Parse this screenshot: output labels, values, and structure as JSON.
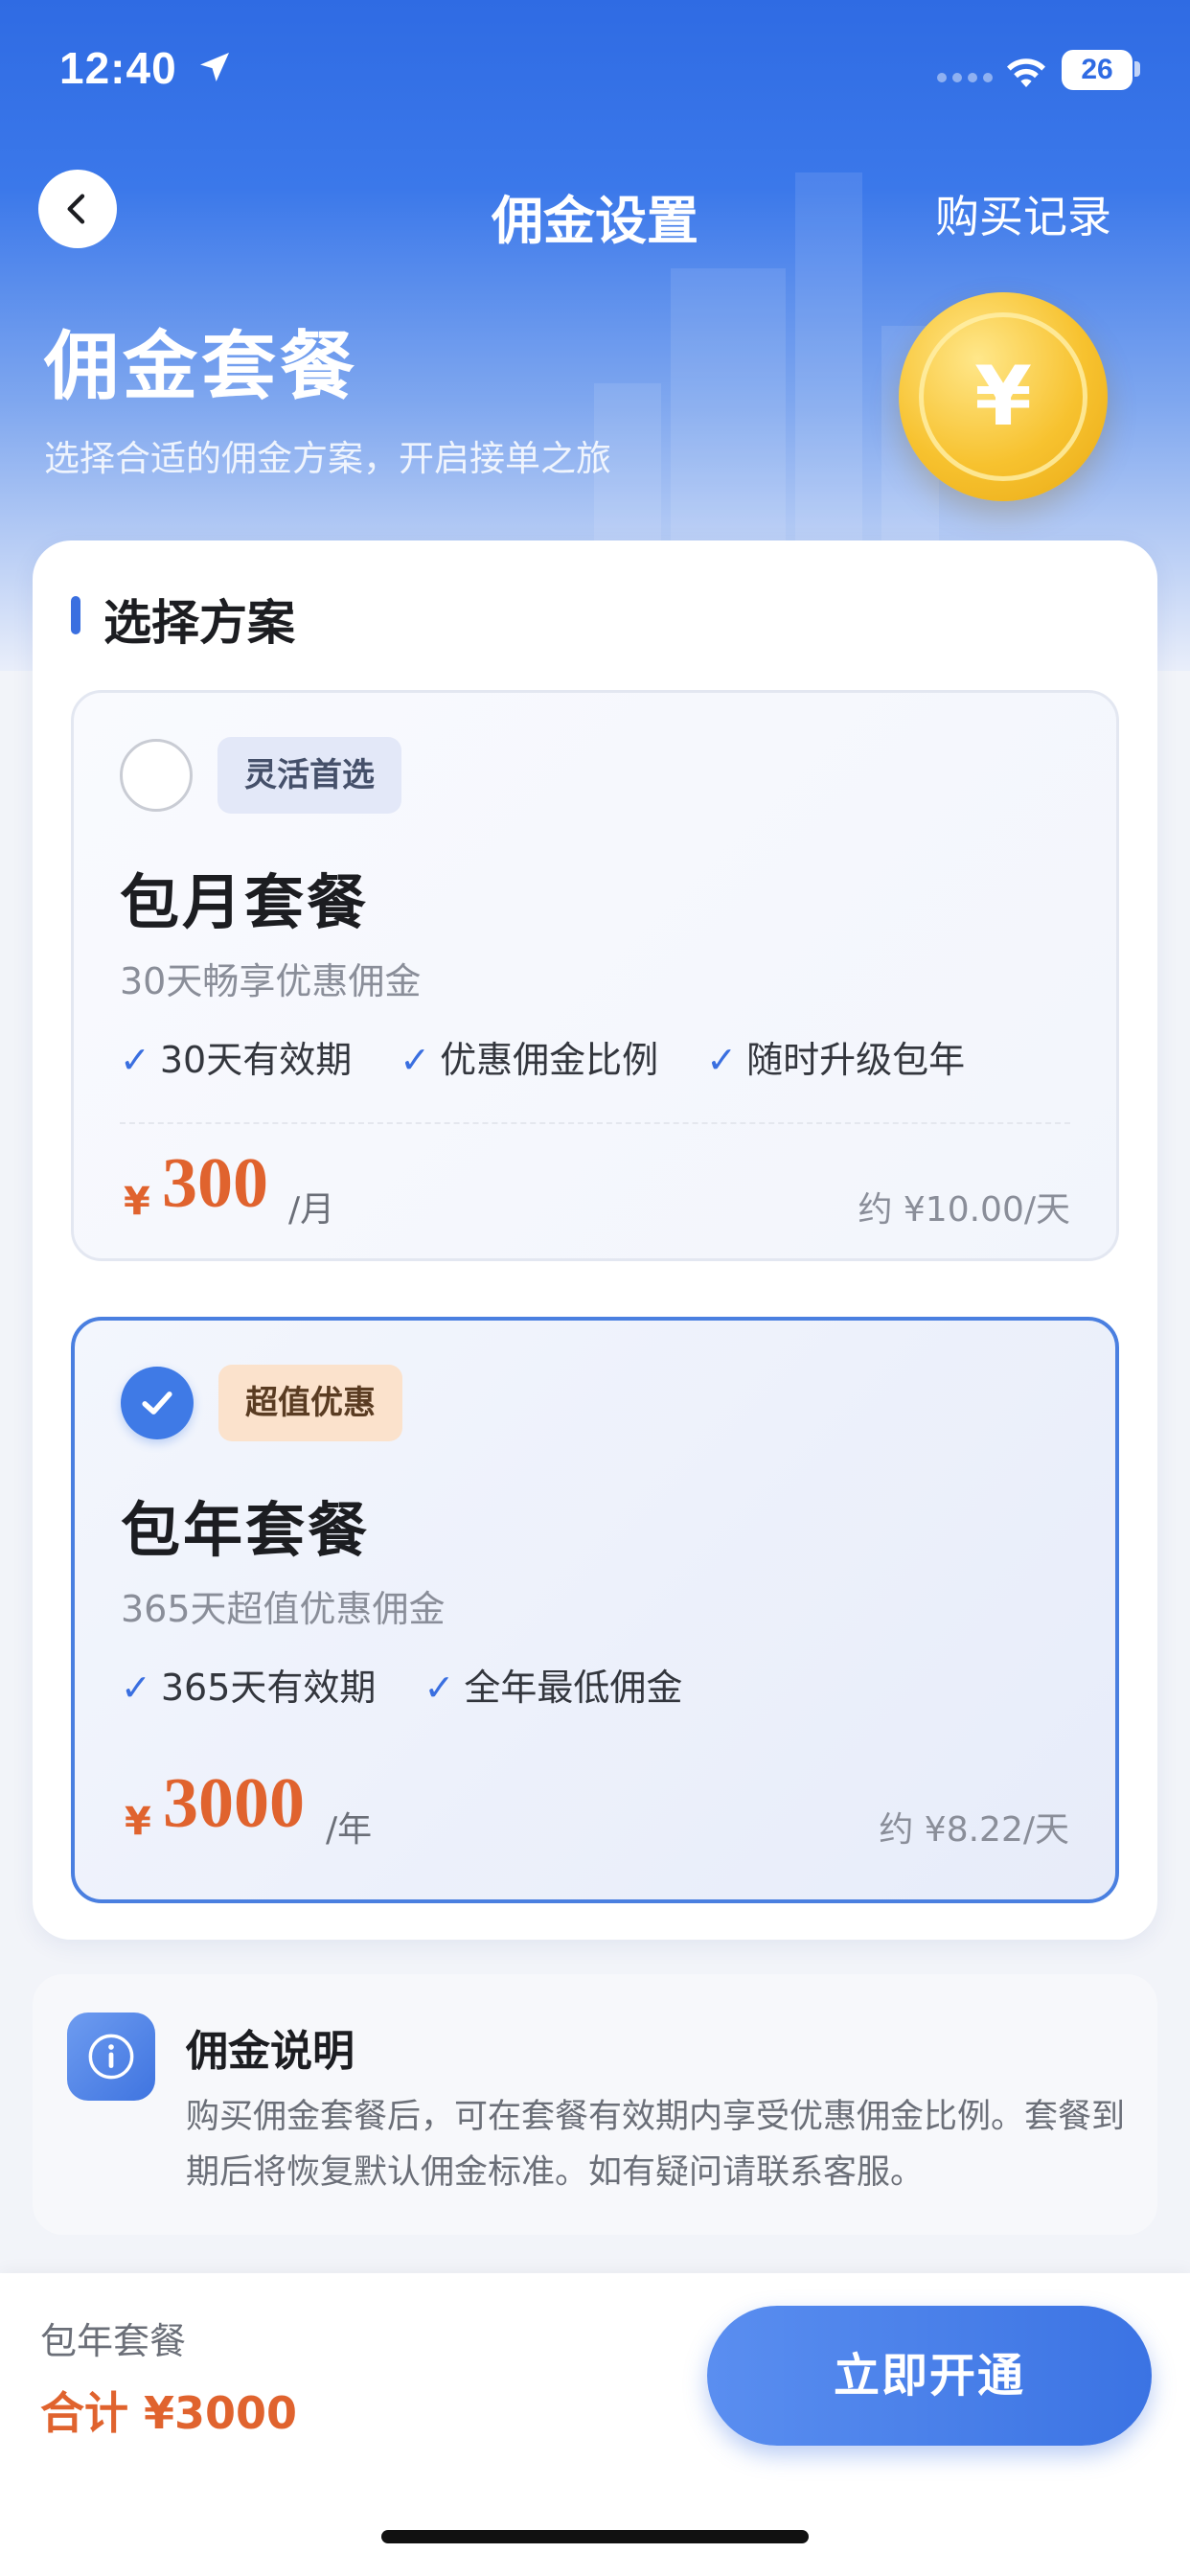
{
  "status_bar": {
    "time": "12:40",
    "battery": "26"
  },
  "nav": {
    "title": "佣金设置",
    "right_link": "购买记录"
  },
  "hero": {
    "title": "佣金套餐",
    "subtitle": "选择合适的佣金方案，开启接单之旅",
    "coin_symbol": "¥"
  },
  "section": {
    "title": "选择方案"
  },
  "plans": [
    {
      "tag": "灵活首选",
      "name": "包月套餐",
      "desc": "30天畅享优惠佣金",
      "features": [
        "30天有效期",
        "优惠佣金比例",
        "随时升级包年"
      ],
      "currency": "¥",
      "price": "300",
      "unit": "/月",
      "per_day": "约 ¥10.00/天",
      "selected": false
    },
    {
      "tag": "超值优惠",
      "name": "包年套餐",
      "desc": "365天超值优惠佣金",
      "features": [
        "365天有效期",
        "全年最低佣金"
      ],
      "currency": "¥",
      "price": "3000",
      "unit": "/年",
      "per_day": "约 ¥8.22/天",
      "selected": true
    }
  ],
  "info": {
    "title": "佣金说明",
    "text": "购买佣金套餐后，可在套餐有效期内享受优惠佣金比例。套餐到期后将恢复默认佣金标准。如有疑问请联系客服。"
  },
  "bottom": {
    "plan_name": "包年套餐",
    "total": "合计 ¥3000",
    "cta": "立即开通"
  },
  "colors": {
    "primary": "#3a6fe0",
    "price": "#e0632e",
    "coin": "#f7c22f"
  },
  "icons": [
    "location-arrow-icon",
    "wifi-icon",
    "back-chevron-icon",
    "yen-coin-icon",
    "check-icon",
    "info-icon"
  ]
}
